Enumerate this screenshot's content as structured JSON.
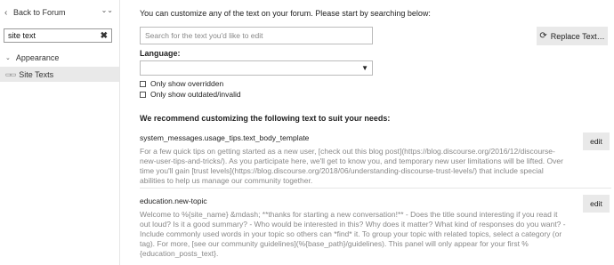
{
  "sidebar": {
    "back_label": "Back to Forum",
    "filter_value": "site text",
    "clear_symbol": "✖",
    "category": "Appearance",
    "active_item": "Site Texts"
  },
  "main": {
    "intro": "You can customize any of the text on your forum. Please start by searching below:",
    "search_placeholder": "Search for the text you'd like to edit",
    "replace_label": "Replace Text…",
    "language_label": "Language:",
    "language_value": "",
    "option_overridden": "Only show overridden",
    "option_outdated": "Only show outdated/invalid",
    "recommend_heading": "We recommend customizing the following text to suit your needs:",
    "entries": [
      {
        "key": "system_messages.usage_tips.text_body_template",
        "value": "For a few quick tips on getting started as a new user, [check out this blog post](https://blog.discourse.org/2016/12/discourse-new-user-tips-and-tricks/). As you participate here, we'll get to know you, and temporary new user limitations will be lifted. Over time you'll gain [trust levels](https://blog.discourse.org/2018/06/understanding-discourse-trust-levels/) that include special abilities to help us manage our community together.",
        "edit_label": "edit"
      },
      {
        "key": "education.new-topic",
        "value": "Welcome to %{site_name} &mdash; **thanks for starting a new conversation!** - Does the title sound interesting if you read it out loud? Is it a good summary? - Who would be interested in this? Why does it matter? What kind of responses do you want? - Include commonly used words in your topic so others can *find* it. To group your topic with related topics, select a category (or tag). For more, [see our community guidelines](%{base_path}/guidelines). This panel will only appear for your first %{education_posts_text}.",
        "edit_label": "edit"
      }
    ]
  }
}
